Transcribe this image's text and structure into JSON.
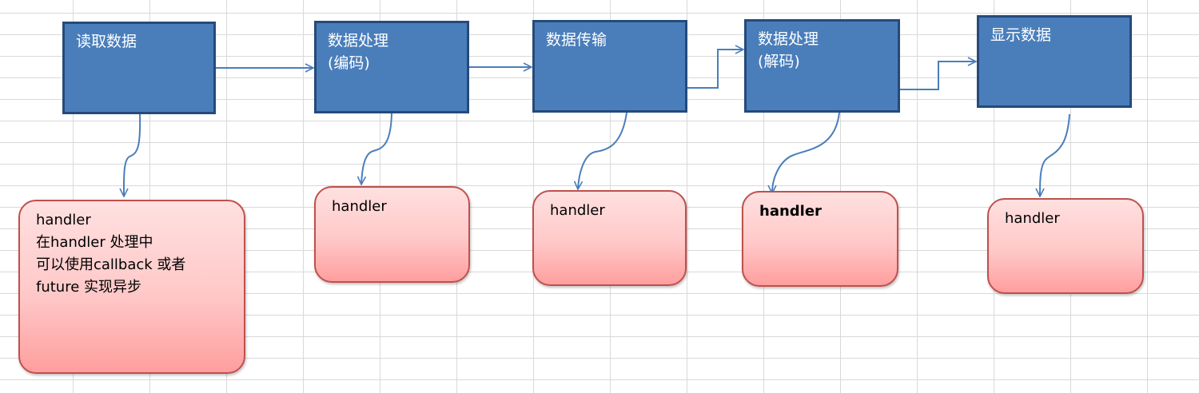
{
  "stages": [
    {
      "id": "read",
      "lines": [
        "读取数据"
      ]
    },
    {
      "id": "encode",
      "lines": [
        "数据处理",
        "(编码)"
      ]
    },
    {
      "id": "transfer",
      "lines": [
        "数据传输"
      ]
    },
    {
      "id": "decode",
      "lines": [
        "数据处理",
        "(解码)"
      ]
    },
    {
      "id": "display",
      "lines": [
        "显示数据"
      ]
    }
  ],
  "handlers": [
    {
      "lines": [
        "handler",
        "在handler 处理中",
        "可以使用callback 或者",
        "future 实现异步"
      ]
    },
    {
      "lines": [
        "handler"
      ]
    },
    {
      "lines": [
        "handler"
      ]
    },
    {
      "lines": [
        "handler"
      ]
    },
    {
      "lines": [
        "handler"
      ]
    }
  ],
  "colors": {
    "stage_fill": "#4a7ebb",
    "stage_border": "#254a7a",
    "handler_border": "#c0504d",
    "arrow": "#4a7ebb",
    "grid": "#d9d9d9"
  }
}
